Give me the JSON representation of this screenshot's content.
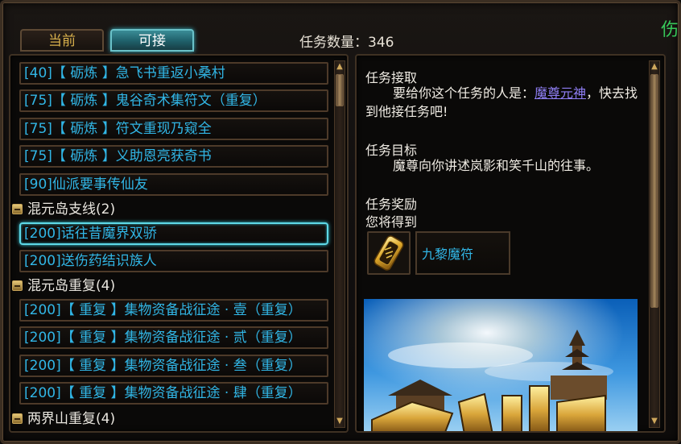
{
  "tabs": {
    "current_label": "当前",
    "available_label": "可接"
  },
  "quest_count": {
    "label": "任务数量：346"
  },
  "corner_text": "伤",
  "quest_list": {
    "rows": [
      {
        "text": "[40]【 砺炼 】急飞书重返小桑村"
      },
      {
        "text": "[75]【 砺炼 】鬼谷奇术集符文（重复）"
      },
      {
        "text": "[75]【 砺炼 】符文重现乃窥全"
      },
      {
        "text": "[75]【 砺炼 】义助恩亮获奇书"
      },
      {
        "text": "[90]仙派要事传仙友"
      },
      {
        "text": "[200]话往昔魔界双骄"
      },
      {
        "text": "[200]送伤药结识族人"
      },
      {
        "text": "[200]【 重复 】集物资备战征途 · 壹（重复）"
      },
      {
        "text": "[200]【 重复 】集物资备战征途 · 贰（重复）"
      },
      {
        "text": "[200]【 重复 】集物资备战征途 · 叁（重复）"
      },
      {
        "text": "[200]【 重复 】集物资备战征途 · 肆（重复）"
      }
    ],
    "groups": [
      {
        "label": "混元岛支线(2)"
      },
      {
        "label": "混元岛重复(4)"
      },
      {
        "label": "两界山重复(4)"
      }
    ]
  },
  "detail": {
    "accept_title": "任务接取",
    "accept_prefix": "要给你这个任务的人是：",
    "npc_name": "魔尊元神",
    "accept_suffix": "，快去找到他接任务吧!",
    "goal_title": "任务目标",
    "goal_text": "魔尊向你讲述岚影和笑千山的往事。",
    "reward_title": "任务奖励",
    "reward_subtitle": "您将得到",
    "reward_item": "九黎魔符",
    "reward_icon": "golden-talisman-icon"
  },
  "colors": {
    "quest_text": "#31b6e6",
    "npc_link": "#8f7ef4",
    "tab_active": "#1f5f69",
    "tab_inactive_text": "#d8b04c"
  }
}
